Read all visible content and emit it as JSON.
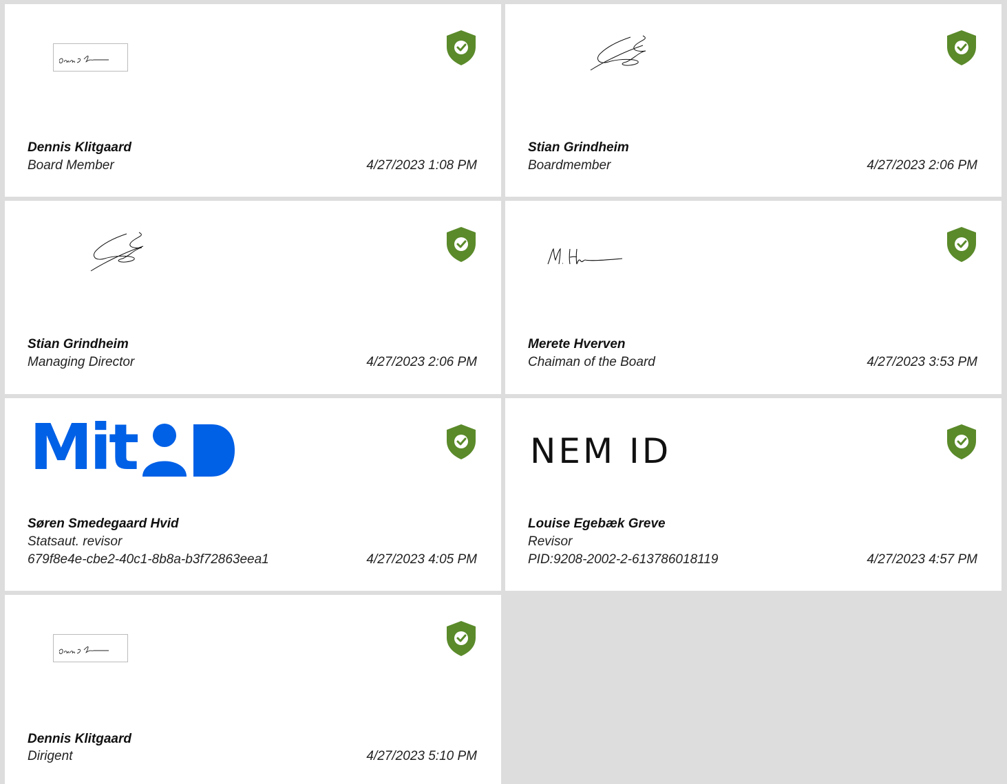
{
  "colors": {
    "background": "#dddddd",
    "card": "#ffffff",
    "shield": "#5a8a2a",
    "mitid_blue": "#0060e6"
  },
  "signatures": [
    {
      "name": "Dennis Klitgaard",
      "role": "Board Member",
      "datetime": "4/27/2023 1:08 PM",
      "signature_icon": "handwritten-signature",
      "verified_icon": "shield-check-icon"
    },
    {
      "name": "Stian Grindheim",
      "role": "Boardmember",
      "datetime": "4/27/2023 2:06 PM",
      "signature_icon": "handwritten-signature",
      "verified_icon": "shield-check-icon"
    },
    {
      "name": "Stian Grindheim",
      "role": "Managing Director",
      "datetime": "4/27/2023 2:06 PM",
      "signature_icon": "handwritten-signature",
      "verified_icon": "shield-check-icon"
    },
    {
      "name": "Merete Hverven",
      "role": "Chaiman of the Board",
      "datetime": "4/27/2023 3:53 PM",
      "signature_icon": "handwritten-signature",
      "verified_icon": "shield-check-icon"
    },
    {
      "name": "Søren Smedegaard Hvid",
      "role": "Statsaut. revisor",
      "identifier": "679f8e4e-cbe2-40c1-8b8a-b3f72863eea1",
      "datetime": "4/27/2023 4:05 PM",
      "logo_text": "Mit",
      "signature_icon": "mitid-logo",
      "verified_icon": "shield-check-icon"
    },
    {
      "name": "Louise Egebæk Greve",
      "role": "Revisor",
      "identifier": "PID:9208-2002-2-613786018119",
      "datetime": "4/27/2023 4:57 PM",
      "logo_text": "NEM ID",
      "signature_icon": "nemid-logo",
      "verified_icon": "shield-check-icon"
    },
    {
      "name": "Dennis Klitgaard",
      "role": "Dirigent",
      "datetime": "4/27/2023 5:10 PM",
      "signature_icon": "handwritten-signature",
      "verified_icon": "shield-check-icon"
    }
  ]
}
